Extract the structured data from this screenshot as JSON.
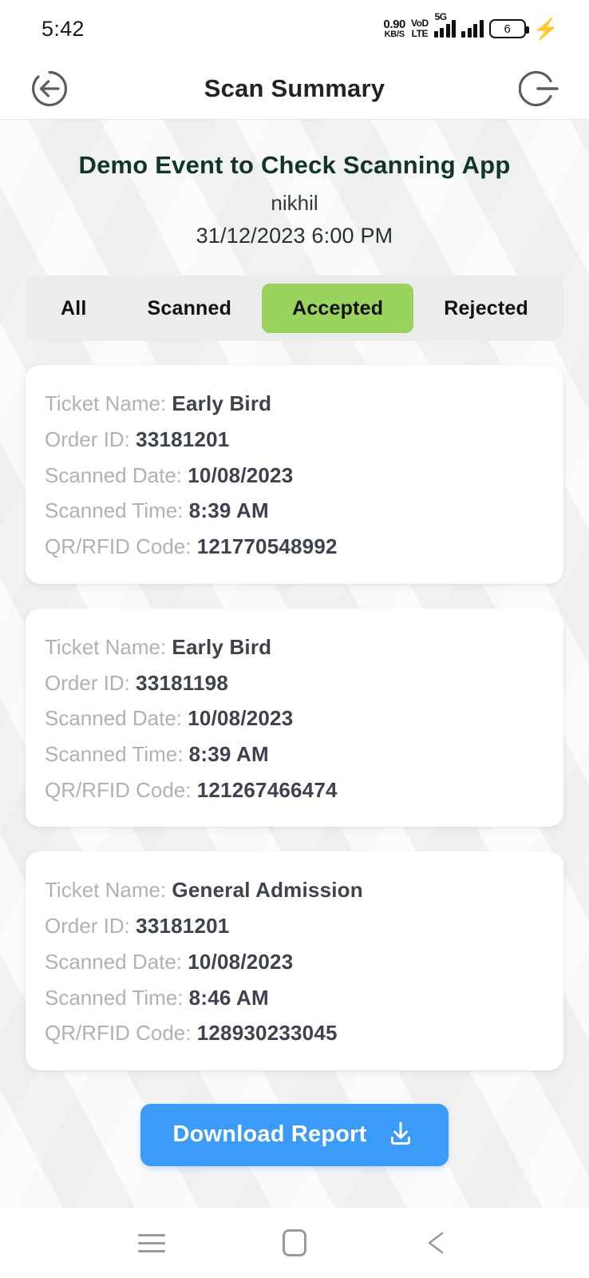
{
  "status_bar": {
    "time": "5:42",
    "net_speed_value": "0.90",
    "net_speed_unit": "KB/S",
    "volte_line1": "VoD",
    "volte_line2": "LTE",
    "network_tag": "5G",
    "battery_level": "6",
    "charging_icon": "charging-bolt-icon"
  },
  "app_bar": {
    "title": "Scan Summary",
    "back_icon": "back-arrow-circle-icon",
    "logout_icon": "logout-circle-icon"
  },
  "event": {
    "title": "Demo Event to Check Scanning App",
    "host": "nikhil",
    "datetime": "31/12/2023 6:00 PM"
  },
  "tabs": {
    "active_index": 2,
    "items": [
      {
        "label": "All"
      },
      {
        "label": "Scanned"
      },
      {
        "label": "Accepted"
      },
      {
        "label": "Rejected"
      }
    ]
  },
  "labels": {
    "ticket_name": "Ticket Name:",
    "order_id": "Order ID:",
    "scanned_date": "Scanned Date:",
    "scanned_time": "Scanned Time:",
    "qr_rfid_code": "QR/RFID Code:"
  },
  "cards": [
    {
      "ticket_name": "Early Bird",
      "order_id": "33181201",
      "scanned_date": "10/08/2023",
      "scanned_time": "8:39 AM",
      "qr_rfid_code": "121770548992"
    },
    {
      "ticket_name": "Early Bird",
      "order_id": "33181198",
      "scanned_date": "10/08/2023",
      "scanned_time": "8:39 AM",
      "qr_rfid_code": "121267466474"
    },
    {
      "ticket_name": "General Admission",
      "order_id": "33181201",
      "scanned_date": "10/08/2023",
      "scanned_time": "8:46 AM",
      "qr_rfid_code": "128930233045"
    }
  ],
  "download": {
    "label": "Download Report",
    "icon": "download-icon"
  },
  "nav_bar": {
    "recents_icon": "recents-menu-icon",
    "home_icon": "home-square-icon",
    "back_icon": "back-triangle-icon"
  },
  "colors": {
    "accent_green": "#9ad45f",
    "accent_blue": "#3b9bf7",
    "title_green": "#11352b",
    "label_gray": "#b0b1b6",
    "value_dark": "#3d424d",
    "tab_track": "#ececec"
  }
}
